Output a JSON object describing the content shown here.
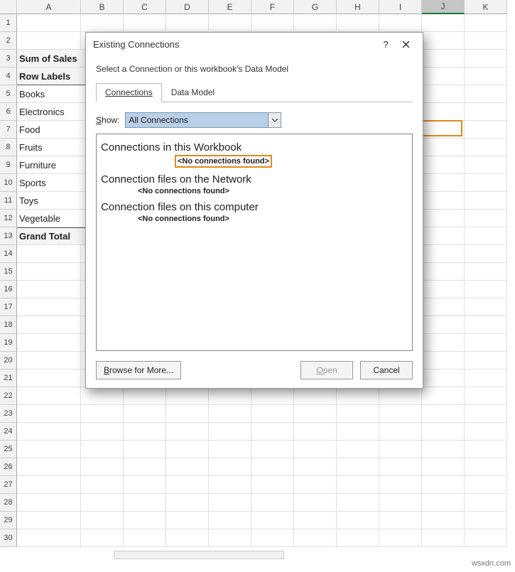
{
  "columns": [
    "A",
    "B",
    "C",
    "D",
    "E",
    "F",
    "G",
    "H",
    "I",
    "J",
    "K"
  ],
  "selected_column": "J",
  "selected_cell": {
    "col": "J",
    "row": 7
  },
  "pivot": {
    "values_label": "Sum of Sales",
    "row_labels": "Row Labels",
    "items": [
      "Books",
      "Electronics",
      "Food",
      "Fruits",
      "Furniture",
      "Sports",
      "Toys",
      "Vegetable"
    ],
    "grand_total": "Grand Total"
  },
  "dialog": {
    "title": "Existing Connections",
    "instruction": "Select a Connection or this workbook's Data Model",
    "tabs": {
      "connections": "Connections",
      "data_model": "Data Model"
    },
    "show_label": "Show:",
    "show_value": "All Connections",
    "groups": [
      {
        "title": "Connections in this Workbook",
        "empty": "<No connections found>"
      },
      {
        "title": "Connection files on the Network",
        "empty": "<No connections found>"
      },
      {
        "title": "Connection files on this computer",
        "empty": "<No connections found>"
      }
    ],
    "buttons": {
      "browse": "Browse for More...",
      "open": "Open",
      "cancel": "Cancel"
    }
  },
  "watermark": "wsxdn.com"
}
